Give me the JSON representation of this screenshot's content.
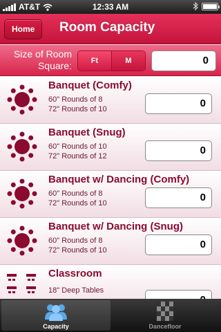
{
  "status_bar": {
    "carrier": "AT&T",
    "time": "12:33 AM"
  },
  "nav_bar": {
    "back_label": "Home",
    "title": "Room Capacity"
  },
  "size_bar": {
    "label_line1": "Size of Room",
    "label_line2": "Square:",
    "unit_options": [
      "Ft",
      "M"
    ],
    "selected_unit": "Ft",
    "value": "0"
  },
  "rows": [
    {
      "title": "Banquet (Comfy)",
      "line1": "60\" Rounds of 8",
      "line2": "72\" Rounds of 10",
      "value": "0",
      "icon": "round-table-icon"
    },
    {
      "title": "Banquet (Snug)",
      "line1": "60\" Rounds of 10",
      "line2": "72\" Rounds of 12",
      "value": "0",
      "icon": "round-table-icon"
    },
    {
      "title": "Banquet w/ Dancing (Comfy)",
      "line1": "60\" Rounds of 8",
      "line2": "72\" Rounds of 10",
      "value": "0",
      "icon": "round-table-icon"
    },
    {
      "title": "Banquet w/ Dancing (Snug)",
      "line1": "60\" Rounds of 8",
      "line2": "72\" Rounds of 10",
      "value": "0",
      "icon": "round-table-icon"
    },
    {
      "title": "Classroom",
      "line1": "18\" Deep Tables",
      "line2": "",
      "value": "0",
      "icon": "classroom-icon"
    }
  ],
  "tab_bar": {
    "tabs": [
      {
        "label": "Capacity",
        "icon": "people-icon",
        "active": true
      },
      {
        "label": "Dancefloor",
        "icon": "checkered-floor-icon",
        "active": false
      }
    ]
  },
  "colors": {
    "accent": "#d21a44",
    "text_dark_red": "#8b0a30"
  }
}
